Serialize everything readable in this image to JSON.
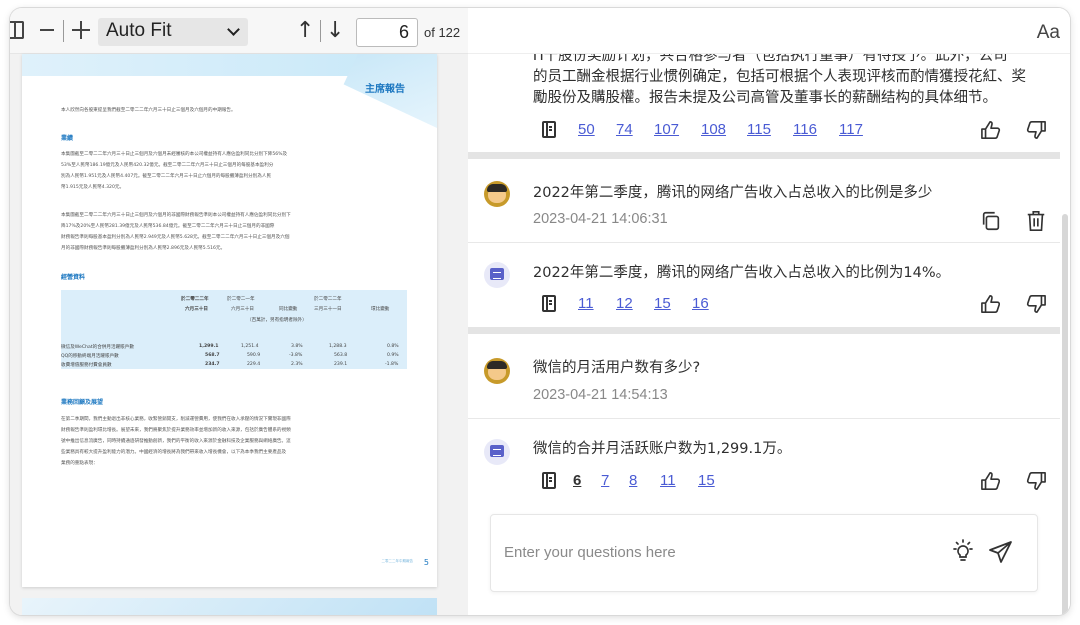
{
  "pdf_toolbar": {
    "zoom_value": "Auto Fit",
    "page_current": "6",
    "page_total_label": "of 122"
  },
  "pdf_page": {
    "heading": "主席報告",
    "intro": "本人欣然向各股東提呈我們截至二零二二年六月三十日止三個月及六個月的中期報告。",
    "section_results": "業績",
    "para1_line1": "本集團截至二零二二年六月三十日止三個月及六個月未經審核的本公司權益持有人應佔盈利同比分別下降56%及",
    "para1_line2": "53%至人民幣186.19億元及人民幣420.32億元。截至二零二二年六月三十日止三個月的每股基本盈利分",
    "para1_line3": "別為人民幣1.951元及人民幣4.407元。截至二零二二年六月三十日止六個月的每股攤薄盈利分別為人民",
    "para1_line4": "幣1.915元及人民幣4.320元。",
    "para2_line1": "本集團截至二零二二年六月三十日止三個月及六個月的非國際財務報告準則本公司權益持有人應佔盈利同比分別下",
    "para2_line2": "降17%及20%至人民幣281.39億元及人民幣536.84億元。截至二零二二年六月三十日止三個月的非國際",
    "para2_line3": "財務報告準則每股基本盈利分別為人民幣2.949元及人民幣5.628元。截至二零二二年六月三十日止三個月及六個",
    "para2_line4": "月的非國際財務報告準則每股攤薄盈利分別為人民幣2.896元及人民幣5.516元。",
    "section_ops": "經營資料",
    "table_head_1": "於二零二二年",
    "table_head_1b": "六月三十日",
    "table_head_2": "於二零二一年",
    "table_head_2b": "六月三十日",
    "table_head_3": "同比變動",
    "table_head_4": "於二零二二年",
    "table_head_4b": "三月三十一日",
    "table_head_5": "環比變動",
    "table_unit": "（百萬計，另有指明者除外）",
    "rows": [
      {
        "label": "微信及WeChat的合併月活躍賬戶數",
        "v1": "1,299.1",
        "v2": "1,251.4",
        "v3": "3.8%",
        "v4": "1,288.3",
        "v5": "0.8%"
      },
      {
        "label": "QQ的移動終端月活躍賬戶數",
        "v1": "568.7",
        "v2": "590.9",
        "v3": "-3.8%",
        "v4": "563.8",
        "v5": "0.9%"
      },
      {
        "label": "收費增值服務付費會員數",
        "v1": "234.7",
        "v2": "229.4",
        "v3": "2.3%",
        "v4": "239.1",
        "v5": "-1.8%"
      }
    ],
    "section_review": "業務回顧及展望",
    "para3_line1": "在第二季期間，我們主動退出非核心業務，收緊營銷開支，削減運營費用，使我們在收入承壓的情況下實現非國際",
    "para3_line2": "財務報告準則盈利環比增長。展望未來，我們將聚焦於提升業務效率並增加新的收入來源，包括於廣告體系的視頻",
    "para3_line3": "號中推出信息流廣告，同時持續通過研發推動創新，我們的平衡的收入來源於金融科技及企業服務與網絡廣告。這",
    "para3_line4": "些業務具有較大提升盈利能力的潛力。中國經濟的增長將為我們帶來收入增長機會，以下為本季我們主要產品及",
    "para3_line5": "業務的重點表現：",
    "footer_text": "二零二二年中期報告",
    "footer_page": "5"
  },
  "chat": {
    "font_toggle": "Aa",
    "messages": [
      {
        "role": "bot",
        "text_line1": "Ո十股份奖励计划，共合格参与者（包括执行董事）有待授予。此外，公司",
        "text_line2": "的员工酬金根据行业惯例确定，包括可根据个人表现评核而酌情獲授花紅、奖",
        "text_line3": "勵股份及購股權。报告未提及公司高管及董事长的薪酬结构的具体细节。",
        "refs": [
          "50",
          "74",
          "107",
          "108",
          "115",
          "116",
          "117"
        ]
      },
      {
        "role": "user",
        "text": "2022年第二季度，腾讯的网络广告收入占总收入的比例是多少",
        "time": "2023-04-21 14:06:31"
      },
      {
        "role": "bot",
        "text": "2022年第二季度，腾讯的网络广告收入占总收入的比例为14%。",
        "refs": [
          "11",
          "12",
          "15",
          "16"
        ]
      },
      {
        "role": "user",
        "text": "微信的月活用户数有多少?",
        "time": "2023-04-21 14:54:13"
      },
      {
        "role": "bot",
        "text": "微信的合并月活跃账户数为1,299.1万。",
        "refs": [
          "6",
          "7",
          "8",
          "11",
          "15"
        ],
        "active_ref": "6"
      }
    ],
    "input_placeholder": "Enter your questions here"
  }
}
